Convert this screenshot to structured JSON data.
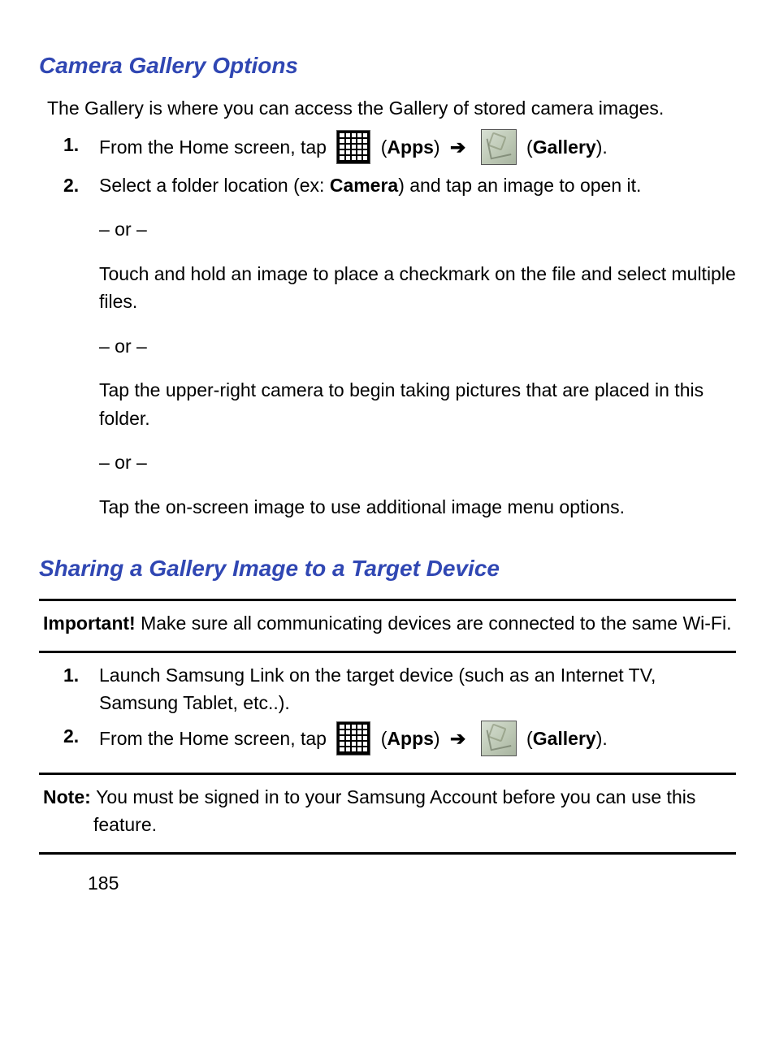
{
  "section1": {
    "heading": "Camera Gallery Options",
    "intro": "The Gallery is where you can access the Gallery of stored camera images.",
    "steps": [
      {
        "num": "1.",
        "prefix": "From the Home screen, tap ",
        "apps_label": "Apps",
        "arrow": "➔",
        "gallery_label": "Gallery",
        "suffix": ")."
      },
      {
        "num": "2.",
        "l1a": "Select a folder location (ex: ",
        "l1b": "Camera",
        "l1c": ") and tap an image to open it.",
        "or": "– or –",
        "l2": "Touch and hold an image to place a checkmark on the file and select multiple files.",
        "l3": "Tap the upper-right camera to begin taking pictures that are placed in this folder.",
        "l4": "Tap the on-screen image to use additional image menu options."
      }
    ]
  },
  "section2": {
    "heading": "Sharing a Gallery Image to a Target Device",
    "important_lead": "Important! ",
    "important_text": "Make sure all communicating devices are connected to the same Wi-Fi.",
    "steps": [
      {
        "num": "1.",
        "text": "Launch Samsung Link on the target device (such as an Internet TV, Samsung Tablet, etc..)."
      },
      {
        "num": "2.",
        "prefix": "From the Home screen, tap ",
        "apps_label": "Apps",
        "arrow": "➔",
        "gallery_label": "Gallery",
        "suffix": ")."
      }
    ],
    "note_lead": "Note: ",
    "note_text": "You must be signed in to your Samsung Account before you can use this feature."
  },
  "page_number": "185"
}
